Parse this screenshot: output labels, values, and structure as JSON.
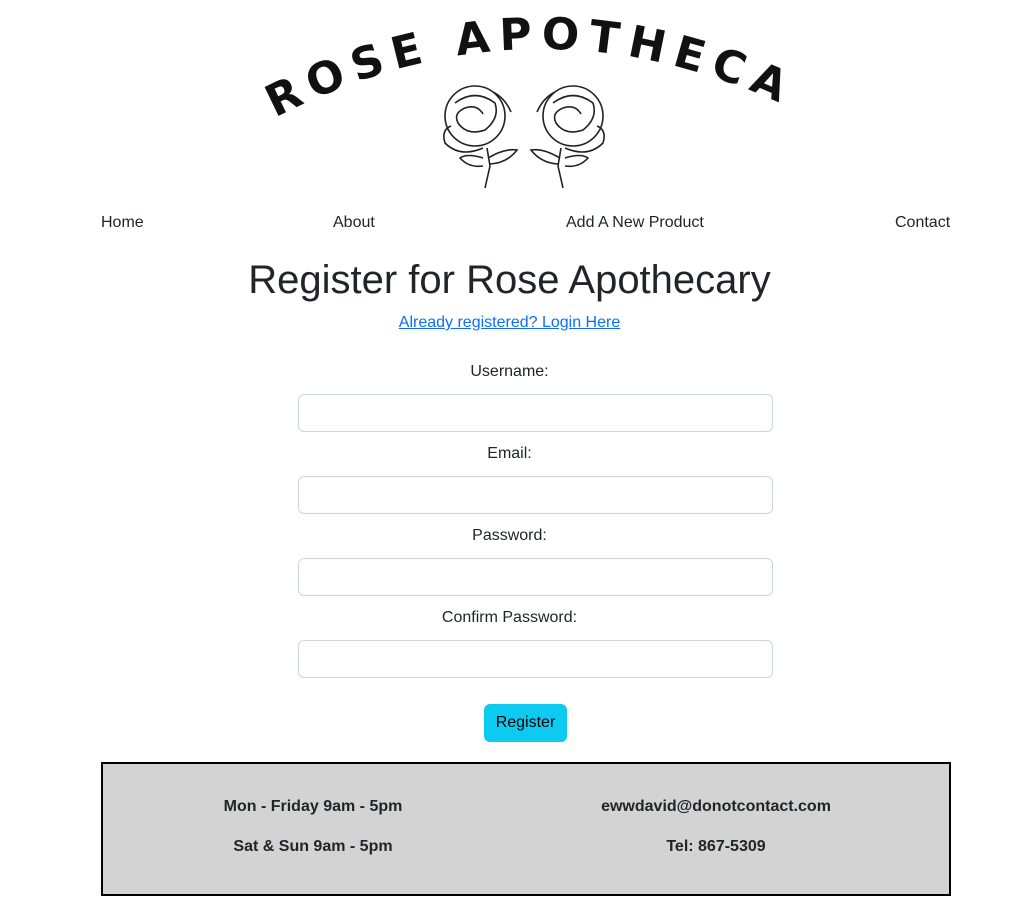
{
  "logo": {
    "brand_text": "ROSE APOTHECARY",
    "icon": "roses-icon"
  },
  "nav": [
    {
      "label": "Home"
    },
    {
      "label": "About"
    },
    {
      "label": "Add A New Product"
    },
    {
      "label": "Contact"
    }
  ],
  "page": {
    "title": "Register for Rose Apothecary",
    "login_link": "Already registered? Login Here"
  },
  "form": {
    "username_label": "Username:",
    "email_label": "Email:",
    "password_label": "Password:",
    "confirm_label": "Confirm Password:",
    "username_value": "",
    "email_value": "",
    "password_value": "",
    "confirm_value": "",
    "submit_label": "Register"
  },
  "footer": {
    "weekday_hours": "Mon - Friday 9am - 5pm",
    "weekend_hours": "Sat & Sun 9am - 5pm",
    "email": "ewwdavid@donotcontact.com",
    "phone": "Tel: 867-5309"
  },
  "colors": {
    "link": "#0d6efd",
    "button": "#0dcaf0",
    "footer_bg": "#d3d3d3"
  }
}
